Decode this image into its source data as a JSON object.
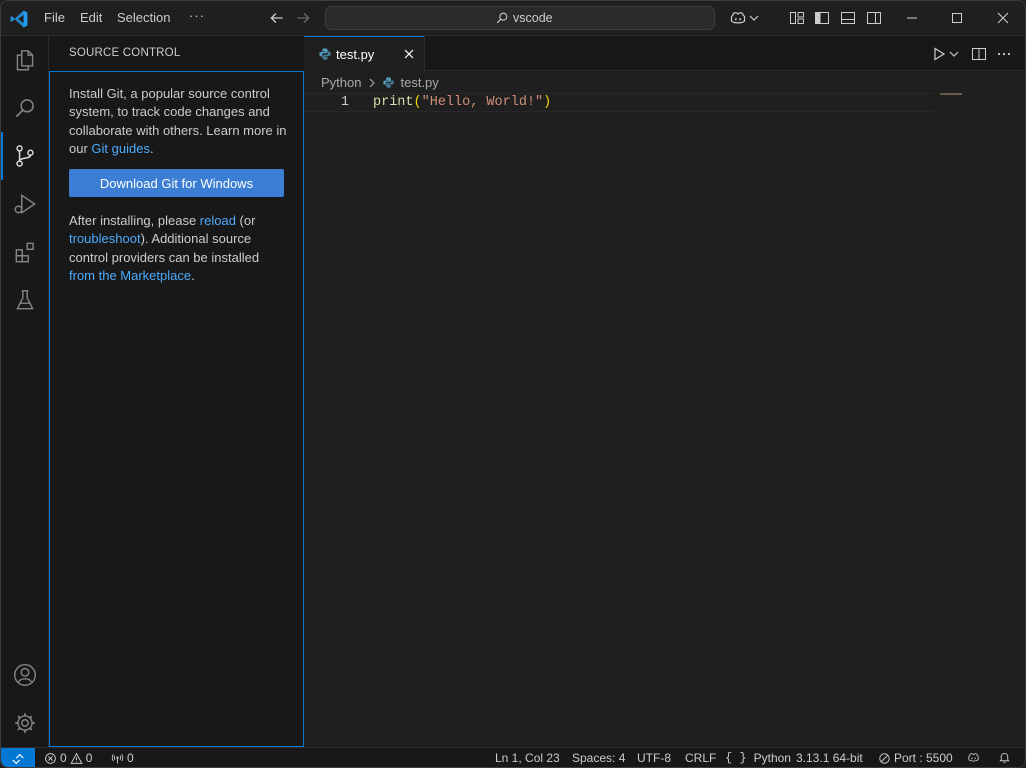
{
  "titlebar": {
    "menus": [
      "File",
      "Edit",
      "Selection",
      "···"
    ],
    "search_label": "vscode"
  },
  "activity_bar": {
    "items": [
      "explorer-icon",
      "search-icon",
      "source-control-icon",
      "run-debug-icon",
      "extensions-icon",
      "testing-icon"
    ],
    "bottom_items": [
      "accounts-icon",
      "manage-gear-icon"
    ]
  },
  "sidebar": {
    "title": "SOURCE CONTROL",
    "intro_text": "Install Git, a popular source control system, to track code changes and collaborate with others. Learn more in our ",
    "intro_link": "Git guides",
    "intro_end": ".",
    "download_button": "Download Git for Windows",
    "after_text_1": "After installing, please ",
    "reload_link": "reload",
    "after_text_2": " (or ",
    "troubleshoot_link": "troubleshoot",
    "after_text_3": "). Additional source control providers can be installed ",
    "marketplace_link": "from the Marketplace",
    "after_text_4": "."
  },
  "editor": {
    "tab_name": "test.py",
    "breadcrumb": [
      "Python",
      "test.py"
    ],
    "line_number": "1",
    "code": {
      "fn": "print",
      "open_paren": "(",
      "string": "\"Hello, World!\"",
      "close_paren": ")"
    }
  },
  "statusbar": {
    "errors": "0",
    "warnings": "0",
    "ports_count": "0",
    "position": "Ln 1, Col 23",
    "spaces": "Spaces: 4",
    "encoding": "UTF-8",
    "eol": "CRLF",
    "language": "Python",
    "interpreter": "3.13.1 64-bit",
    "port": "Port : 5500"
  },
  "colors": {
    "accent": "#0078d4",
    "link": "#4daafc",
    "background": "#1f1f1f",
    "sidebar_bg": "#181818"
  }
}
